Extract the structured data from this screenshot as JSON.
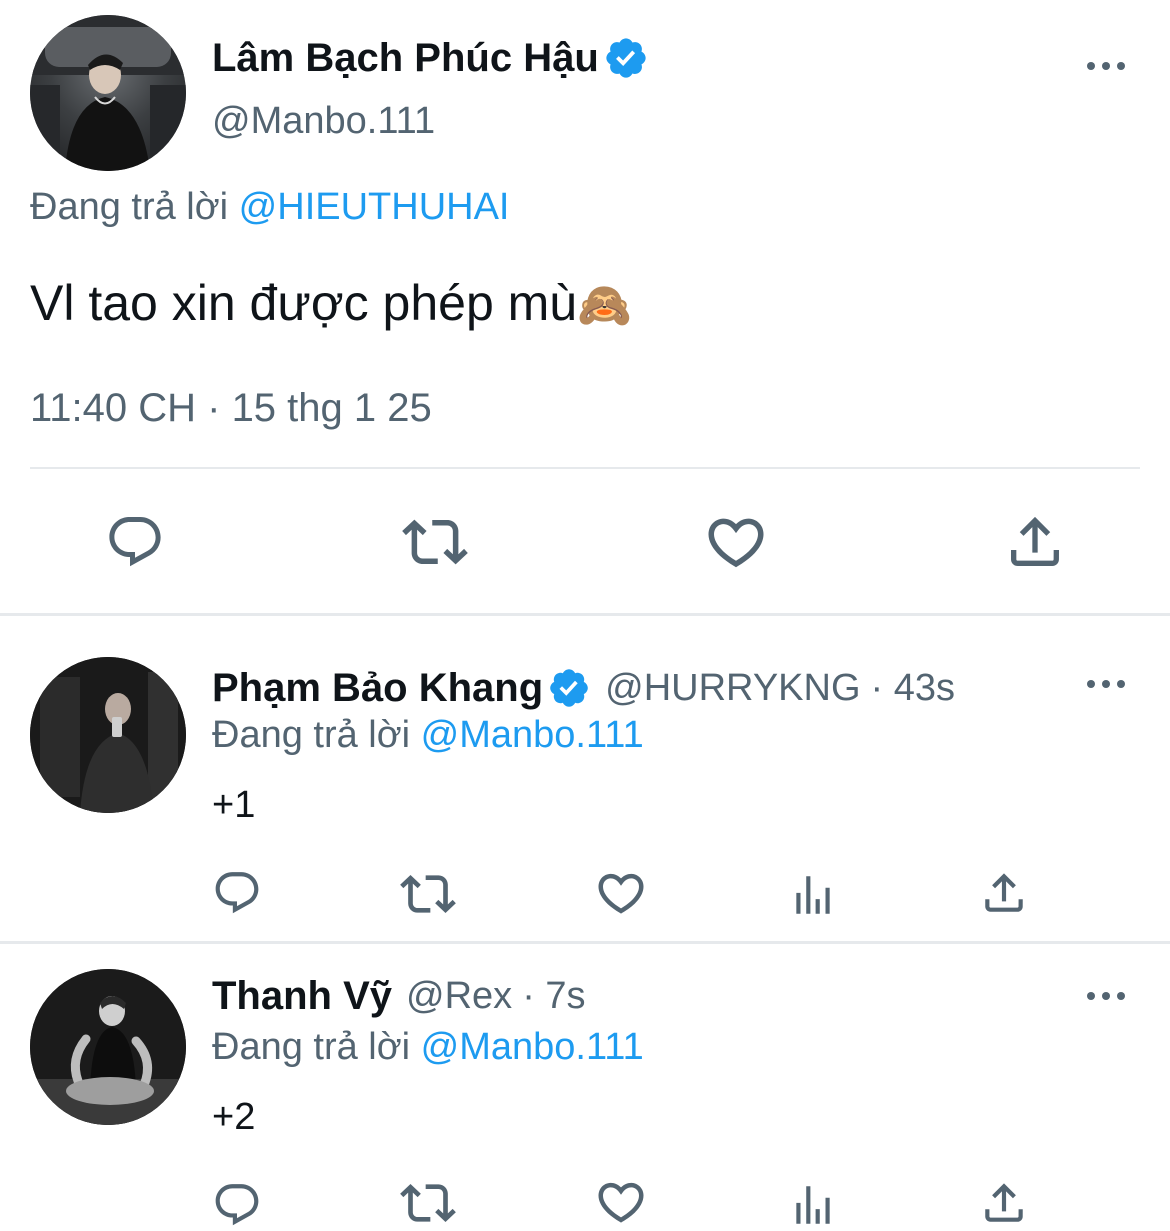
{
  "main_tweet": {
    "author_name": "Lâm Bạch Phúc Hậu",
    "handle": "@Manbo.111",
    "reply_prefix": "Đang trả lời",
    "reply_to": "@HIEUTHUHAI",
    "text": "Vl tao xin được phép mù",
    "emoji": "🙈",
    "timestamp": "11:40 CH · 15 thg 1 25",
    "actions": [
      "reply-icon",
      "retweet-icon",
      "like-icon",
      "share-icon"
    ]
  },
  "replies": [
    {
      "author_name": "Phạm Bảo Khang",
      "verified": true,
      "handle": "@HURRYKNG",
      "time": "· 43s",
      "reply_prefix": "Đang trả lời",
      "reply_to": "@Manbo.111",
      "text": "+1",
      "actions": [
        "reply-icon",
        "retweet-icon",
        "like-icon",
        "views-icon",
        "share-icon"
      ]
    },
    {
      "author_name": "Thanh Vỹ",
      "verified": false,
      "handle": "@Rex",
      "time": "· 7s",
      "reply_prefix": "Đang trả lời",
      "reply_to": "@Manbo.111",
      "text": "+2",
      "actions": [
        "reply-icon",
        "retweet-icon",
        "like-icon",
        "views-icon",
        "share-icon"
      ]
    }
  ],
  "colors": {
    "accent": "#1d9bf0",
    "text": "#0f1419",
    "muted": "#536471",
    "divider": "#e6e9ec"
  }
}
